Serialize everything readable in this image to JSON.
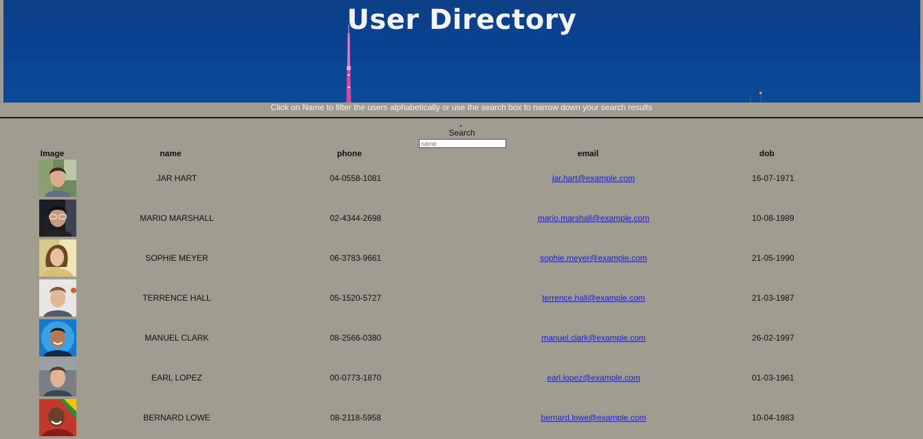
{
  "header": {
    "title": "User Directory",
    "instructions": "Click on Name to filter the users alphabetically or use the search box to narrow down your search results"
  },
  "search": {
    "label": "Search",
    "placeholder": "name",
    "value": ""
  },
  "table": {
    "columns": {
      "image": "Image",
      "name": "name",
      "phone": "phone",
      "email": "email",
      "dob": "dob"
    },
    "rows": [
      {
        "name": "JAR HART",
        "phone": "04-0558-1081",
        "email": "jar.hart@example.com",
        "dob": "16-07-1971"
      },
      {
        "name": "MARIO MARSHALL",
        "phone": "02-4344-2698",
        "email": "mario.marshall@example.com",
        "dob": "10-08-1989"
      },
      {
        "name": "SOPHIE MEYER",
        "phone": "06-3783-9661",
        "email": "sophie.meyer@example.com",
        "dob": "21-05-1990"
      },
      {
        "name": "TERRENCE HALL",
        "phone": "05-1520-5727",
        "email": "terrence.hall@example.com",
        "dob": "21-03-1987"
      },
      {
        "name": "MANUEL CLARK",
        "phone": "08-2566-0380",
        "email": "manuel.clark@example.com",
        "dob": "26-02-1997"
      },
      {
        "name": "EARL LOPEZ",
        "phone": "00-0773-1870",
        "email": "earl.lopez@example.com",
        "dob": "01-03-1961"
      },
      {
        "name": "BERNARD LOWE",
        "phone": "08-2118-5958",
        "email": "bernard.lowe@example.com",
        "dob": "10-04-1983"
      }
    ]
  },
  "colors": {
    "page_background": "#9f9b8f",
    "banner": "#0a4394",
    "link": "#1a1ae6"
  }
}
